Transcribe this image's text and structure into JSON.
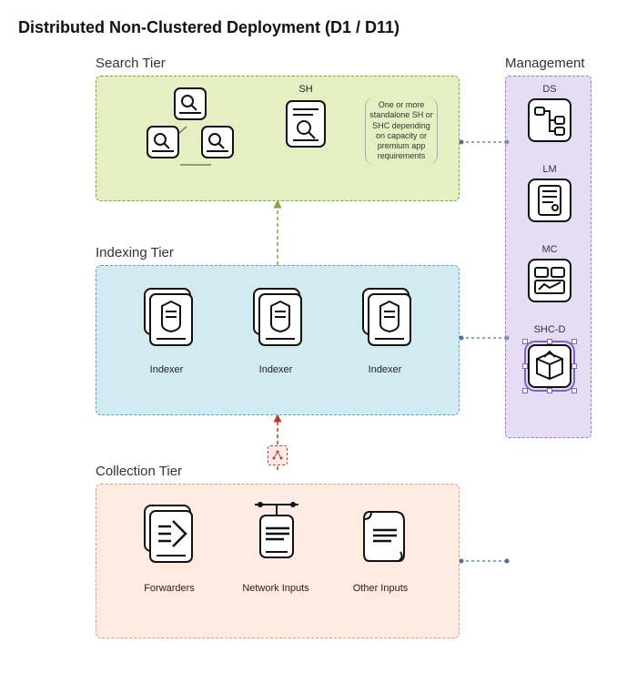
{
  "title": "Distributed Non-Clustered Deployment (D1 / D11)",
  "tiers": {
    "search": {
      "label": "Search Tier",
      "sh_label": "SH",
      "note": "One or more standalone SH or SHC depending on capacity or premium app requirements"
    },
    "indexing": {
      "label": "Indexing Tier",
      "items": [
        "Indexer",
        "Indexer",
        "Indexer"
      ]
    },
    "collection": {
      "label": "Collection Tier",
      "items": [
        "Forwarders",
        "Network Inputs",
        "Other Inputs"
      ]
    }
  },
  "management": {
    "label": "Management",
    "items": [
      {
        "code": "DS",
        "icon": "sitemap-icon"
      },
      {
        "code": "LM",
        "icon": "document-lines-icon"
      },
      {
        "code": "MC",
        "icon": "dashboard-icon"
      },
      {
        "code": "SHC-D",
        "icon": "box-icon",
        "selected": true
      }
    ]
  },
  "colors": {
    "search_border": "#7ea43a",
    "indexing_border": "#4aa8d8",
    "collection_border": "#e39b7a",
    "management_border": "#9a7cc7",
    "accent_red": "#c0392b"
  }
}
